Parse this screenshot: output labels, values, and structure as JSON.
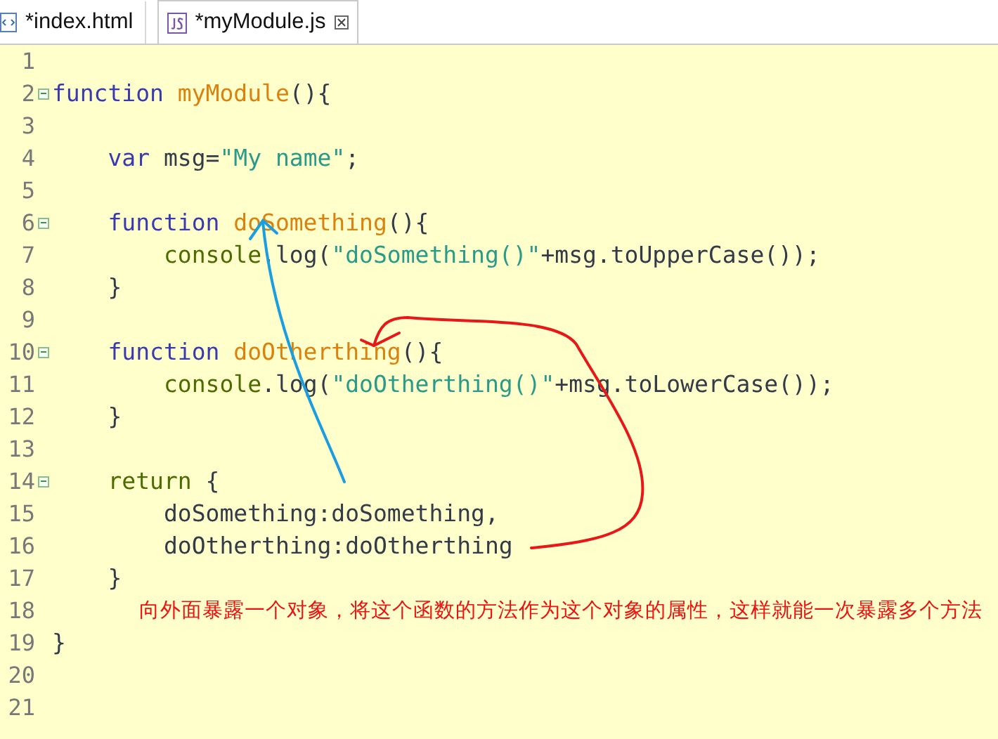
{
  "tabs": [
    {
      "label": "*index.html",
      "kind": "html",
      "selected": false,
      "closable": false
    },
    {
      "label": "*myModule.js",
      "kind": "js",
      "selected": true,
      "closable": true
    }
  ],
  "editor": {
    "lines": [
      {
        "number": "1",
        "fold_marker": false
      },
      {
        "number": "2",
        "fold_marker": true,
        "tokens": [
          {
            "text": "function ",
            "kind": "keyword"
          },
          {
            "text": "myModule",
            "kind": "name"
          },
          {
            "text": "(){",
            "kind": "plain"
          }
        ]
      },
      {
        "number": "3",
        "fold_marker": false
      },
      {
        "number": "4",
        "fold_marker": false,
        "tokens": [
          {
            "text": "    var ",
            "kind": "keyword"
          },
          {
            "text": "msg=",
            "kind": "plain"
          },
          {
            "text": "\"My name\"",
            "kind": "string"
          },
          {
            "text": ";",
            "kind": "plain"
          }
        ]
      },
      {
        "number": "5",
        "fold_marker": false
      },
      {
        "number": "6",
        "fold_marker": true,
        "tokens": [
          {
            "text": "    function ",
            "kind": "keyword"
          },
          {
            "text": "doSomething",
            "kind": "name"
          },
          {
            "text": "(){",
            "kind": "plain"
          }
        ]
      },
      {
        "number": "7",
        "fold_marker": false,
        "tokens": [
          {
            "text": "        console",
            "kind": "builtin"
          },
          {
            "text": ".log(",
            "kind": "plain"
          },
          {
            "text": "\"doSomething()\"",
            "kind": "string"
          },
          {
            "text": "+msg.toUpperCase());",
            "kind": "plain"
          }
        ]
      },
      {
        "number": "8",
        "fold_marker": false,
        "tokens": [
          {
            "text": "    }",
            "kind": "plain"
          }
        ]
      },
      {
        "number": "9",
        "fold_marker": false
      },
      {
        "number": "10",
        "fold_marker": true,
        "tokens": [
          {
            "text": "    function ",
            "kind": "keyword"
          },
          {
            "text": "doOtherthing",
            "kind": "name"
          },
          {
            "text": "(){",
            "kind": "plain"
          }
        ]
      },
      {
        "number": "11",
        "fold_marker": false,
        "tokens": [
          {
            "text": "        console",
            "kind": "builtin"
          },
          {
            "text": ".log(",
            "kind": "plain"
          },
          {
            "text": "\"doOtherthing()\"",
            "kind": "string"
          },
          {
            "text": "+msg.toLowerCase());",
            "kind": "plain"
          }
        ]
      },
      {
        "number": "12",
        "fold_marker": false,
        "tokens": [
          {
            "text": "    }",
            "kind": "plain"
          }
        ]
      },
      {
        "number": "13",
        "fold_marker": false
      },
      {
        "number": "14",
        "fold_marker": true,
        "tokens": [
          {
            "text": "    return ",
            "kind": "builtin"
          },
          {
            "text": "{",
            "kind": "plain"
          }
        ]
      },
      {
        "number": "15",
        "fold_marker": false,
        "tokens": [
          {
            "text": "        doSomething:doSomething,",
            "kind": "plain"
          }
        ]
      },
      {
        "number": "16",
        "fold_marker": false,
        "tokens": [
          {
            "text": "        doOtherthing:doOtherthing",
            "kind": "plain"
          }
        ]
      },
      {
        "number": "17",
        "fold_marker": false,
        "tokens": [
          {
            "text": "    }",
            "kind": "plain"
          }
        ]
      },
      {
        "number": "18",
        "fold_marker": false,
        "tokens": [
          {
            "text": "向外面暴露一个对象，将这个函数的方法作为这个对象的属性，这样就能一次暴露多个方法",
            "kind": "note"
          }
        ]
      },
      {
        "number": "19",
        "fold_marker": false,
        "tokens": [
          {
            "text": "}",
            "kind": "plain"
          }
        ]
      },
      {
        "number": "20",
        "fold_marker": false
      },
      {
        "number": "21",
        "fold_marker": false
      }
    ]
  }
}
